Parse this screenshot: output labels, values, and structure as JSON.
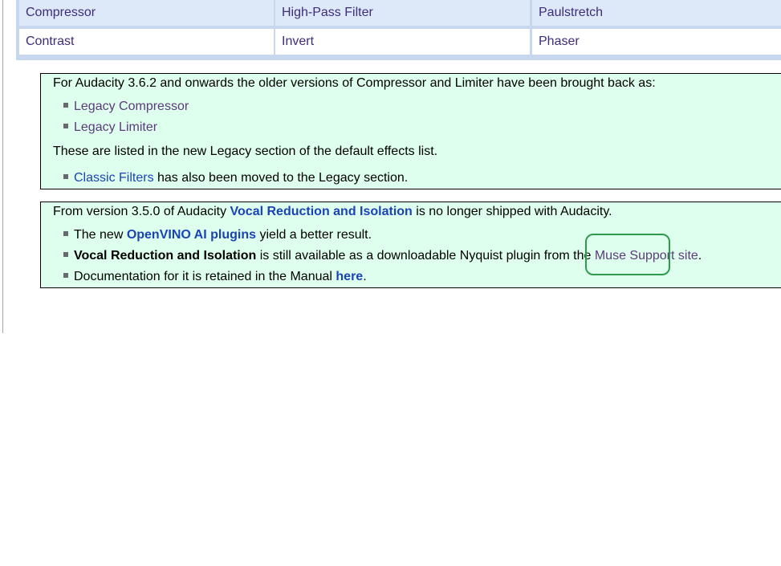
{
  "table": {
    "rows": [
      [
        "Compressor",
        "High-Pass Filter",
        "Paulstretch"
      ],
      [
        "Contrast",
        "Invert",
        "Phaser"
      ]
    ]
  },
  "legacy_box": {
    "intro": "For Audacity 3.6.2 and onwards the older versions of Compressor and Limiter have been brought back as:",
    "items": [
      "Legacy Compressor",
      "Legacy Limiter"
    ],
    "note": "These are listed in the new Legacy section of the default effects list.",
    "classic_link": "Classic Filters",
    "classic_rest": " has also been moved to the Legacy section."
  },
  "vocal_box": {
    "intro_prefix": "From version 3.5.0 of Audacity ",
    "intro_link": "Vocal Reduction and Isolation",
    "intro_suffix": " is no longer shipped with Audacity.",
    "item1_prefix": "The new ",
    "item1_link": "OpenVINO AI plugins",
    "item1_suffix": " yield a better result.",
    "item2_bold": "Vocal Reduction and Isolation",
    "item2_mid": " is still available as a downloadable Nyquist plugin from the ",
    "item2_link1": "Muse Support",
    "item2_link2": " site",
    "item2_end": ".",
    "item3_prefix": "Documentation for it is retained in the Manual ",
    "item3_link": "here",
    "item3_end": "."
  },
  "colors": {
    "table_header_row": "#dde9f9",
    "table_border": "#c6d7ee",
    "note_box_bg": "#deffee",
    "link": "#1b43b4",
    "visited_link": "#5c3b7a",
    "highlight_ring": "#2c9c4a"
  }
}
